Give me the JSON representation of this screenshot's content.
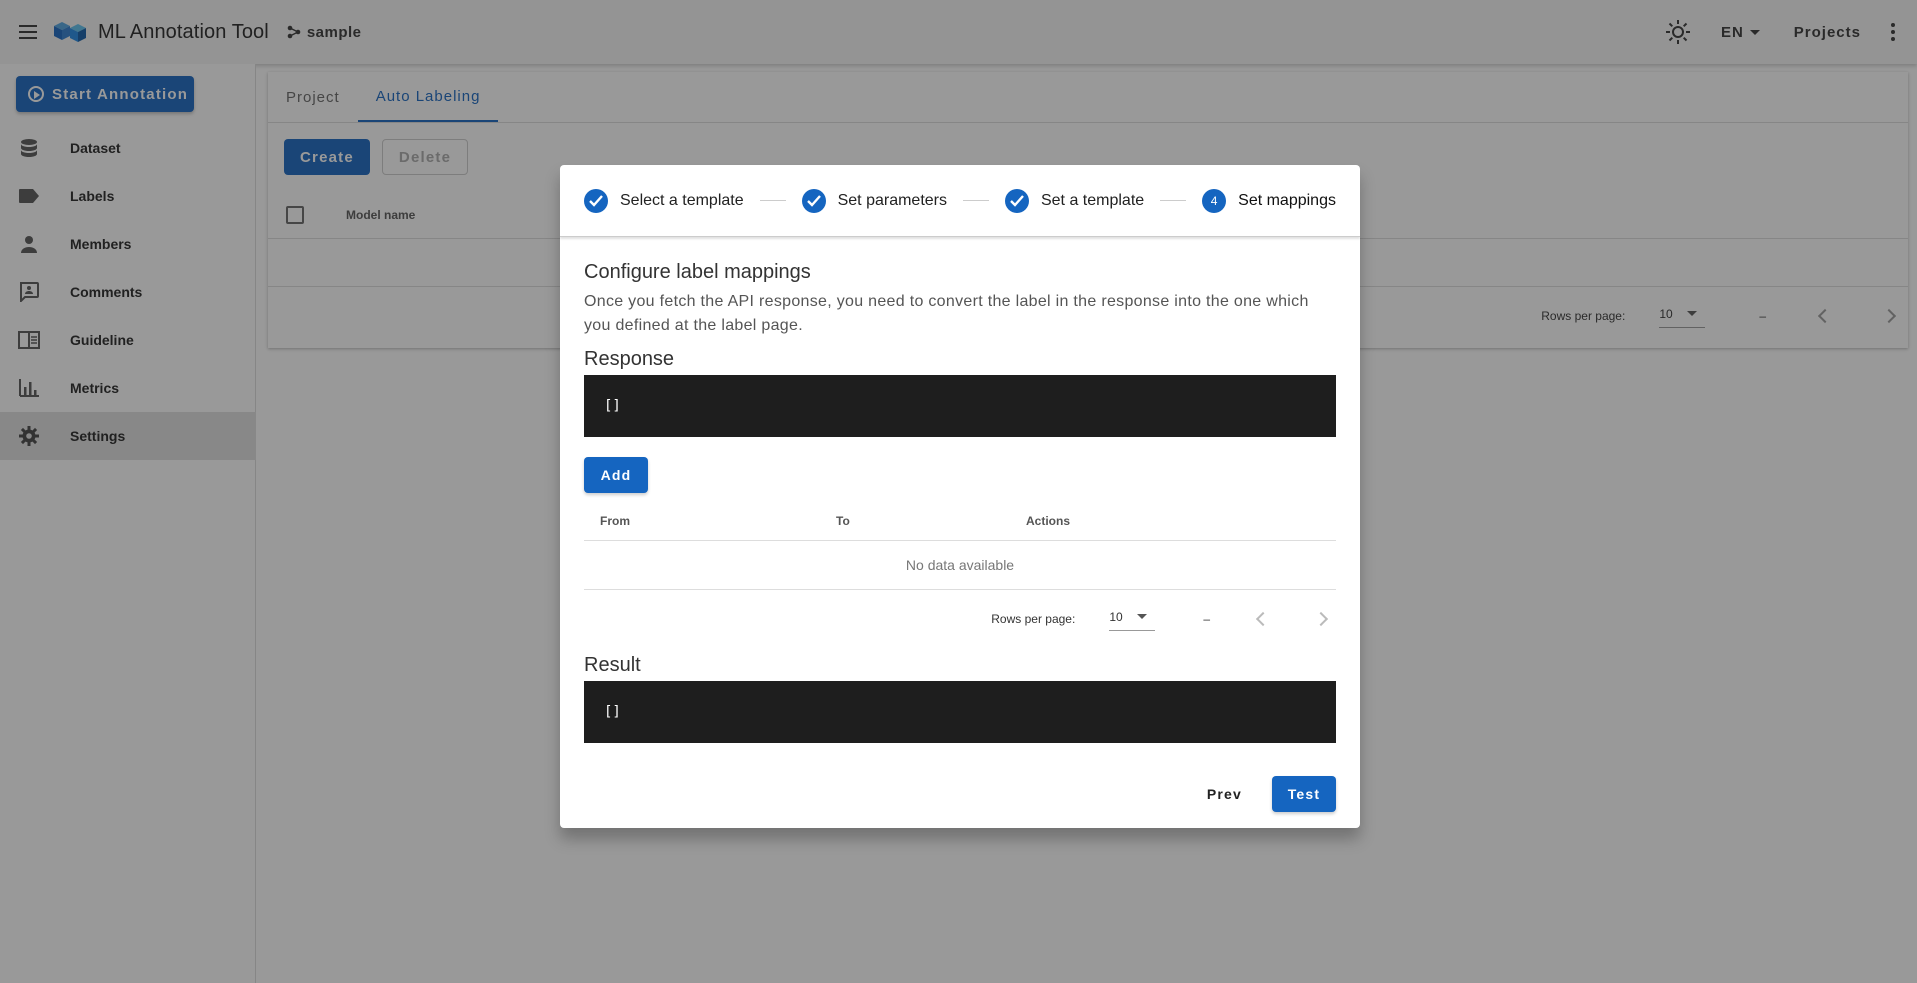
{
  "app": {
    "title": "ML Annotation Tool",
    "project_name": "sample",
    "language": "EN",
    "projects_label": "Projects"
  },
  "sidebar": {
    "start_label": "Start Annotation",
    "items": [
      {
        "label": "Dataset",
        "icon": "database-icon"
      },
      {
        "label": "Labels",
        "icon": "label-icon"
      },
      {
        "label": "Members",
        "icon": "person-icon"
      },
      {
        "label": "Comments",
        "icon": "comment-icon"
      },
      {
        "label": "Guideline",
        "icon": "book-icon"
      },
      {
        "label": "Metrics",
        "icon": "bar-chart-icon"
      },
      {
        "label": "Settings",
        "icon": "gear-icon",
        "active": true
      }
    ]
  },
  "main": {
    "tabs": [
      {
        "label": "Project"
      },
      {
        "label": "Auto Labeling",
        "active": true
      }
    ],
    "create_label": "Create",
    "delete_label": "Delete",
    "table": {
      "columns": [
        "Model name"
      ]
    },
    "pager": {
      "rows_per_page_label": "Rows per page:",
      "rows_per_page": "10",
      "range": "–"
    }
  },
  "dialog": {
    "steps": [
      {
        "label": "Select a template",
        "state": "done"
      },
      {
        "label": "Set parameters",
        "state": "done"
      },
      {
        "label": "Set a template",
        "state": "done"
      },
      {
        "label": "Set mappings",
        "state": "current",
        "number": "4"
      }
    ],
    "title": "Configure label mappings",
    "description": "Once you fetch the API response, you need to convert the label in the response into the one which you defined at the label page.",
    "response_title": "Response",
    "response_value": "[]",
    "add_label": "Add",
    "mapping_table": {
      "columns": [
        "From",
        "To",
        "Actions"
      ],
      "empty_text": "No data available"
    },
    "pager": {
      "rows_per_page_label": "Rows per page:",
      "rows_per_page": "10",
      "range": "–"
    },
    "result_title": "Result",
    "result_value": "[]",
    "prev_label": "Prev",
    "test_label": "Test"
  },
  "colors": {
    "primary": "#1565c0",
    "code_bg": "#1e1e1e",
    "overlay": "rgba(33,33,33,0.46)"
  }
}
